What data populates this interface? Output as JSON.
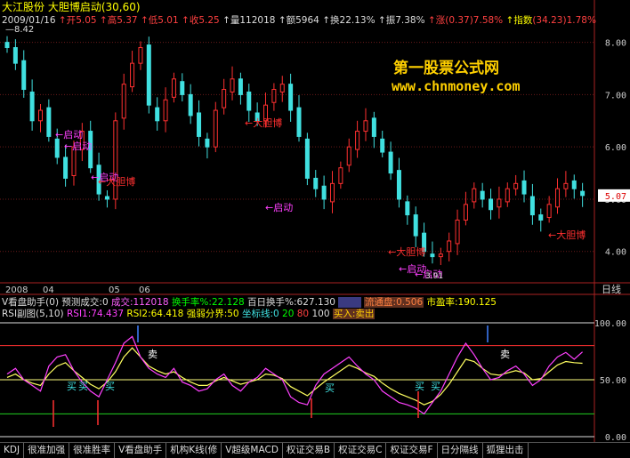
{
  "header": {
    "stock_name": "大江股份",
    "indicator": "大胆博启动(30,60)",
    "date": "2009/01/16",
    "open_label": "↑开",
    "open": "5.05",
    "high_label": "↑高",
    "high": "5.37",
    "low_label": "↑低",
    "low": "5.01",
    "close_label": "↑收",
    "close": "5.25",
    "vol_label": "↑量",
    "vol": "112018",
    "amt_label": "↑额",
    "amt": "5964",
    "turn_label": "↑换",
    "turn": "22.13%",
    "amp_label": "↑振",
    "amp": "7.38%",
    "chg_label": "↑涨",
    "chg": "(0.37)7.58%",
    "idx_label": "↑指数",
    "idx": "(34.23)1.78%",
    "hi_mark": "8.42"
  },
  "watermark": {
    "line1": "第一股票公式网",
    "line2": "www.chnmoney.com"
  },
  "price_axis": {
    "ticks": [
      "8.00",
      "7.00",
      "6.00",
      "5.00",
      "4.00"
    ],
    "current": "5.07"
  },
  "time_axis": {
    "labels": [
      "2008",
      "04",
      "05",
      "06"
    ],
    "period": "日线"
  },
  "annotations": [
    "启动",
    "启动",
    "启动",
    "大胆博",
    "大胆博",
    "启动",
    "大胆博",
    "启动",
    "启动",
    "3.91",
    "大胆博"
  ],
  "info1": {
    "name": "V看盘助手(0)",
    "fc_label": "预测成交:0",
    "deal": "成交:112018",
    "turn": "换手率%:22.128",
    "turn100": "百日换手%:627.130",
    "ltp": "流通盘:0.506",
    "pe": "市盈率:190.125"
  },
  "info2": {
    "name": "RSI副图(5,10)",
    "rsi1": "RSI1:74.437",
    "rsi2": "RSI2:64.418",
    "line": "强弱分界:50",
    "coord": "坐标线:0",
    "v20": "20",
    "v80": "80",
    "v100": "100",
    "signal": "买入:卖出"
  },
  "rsi_axis": {
    "ticks": [
      "100.00",
      "50.00",
      "0.00"
    ]
  },
  "rsi_labels": {
    "buy": "买",
    "sell": "卖"
  },
  "tabs": [
    "KDJ",
    "很准加强",
    "很准胜率",
    "V看盘助手",
    "机构K线(修",
    "V超级MACD",
    "权证交易B",
    "权证交易C",
    "权证交易F",
    "日分隔线",
    "狐狸出击"
  ],
  "chart_data": {
    "type": "candlestick",
    "y_ticks": [
      4,
      5,
      6,
      7,
      8
    ],
    "close_series": [
      7.9,
      7.6,
      7.1,
      6.5,
      6.7,
      6.2,
      5.8,
      5.4,
      6.0,
      6.3,
      5.6,
      5.1,
      5.0,
      6.5,
      7.2,
      7.6,
      7.9,
      6.8,
      6.5,
      6.9,
      7.3,
      7.0,
      6.6,
      6.2,
      6.0,
      6.7,
      7.1,
      7.3,
      7.0,
      6.7,
      6.5,
      6.8,
      7.1,
      7.2,
      6.7,
      6.2,
      5.4,
      5.2,
      5.0,
      5.3,
      5.6,
      6.0,
      6.3,
      6.5,
      6.2,
      5.9,
      5.5,
      5.0,
      4.7,
      4.3,
      4.0,
      3.9,
      3.95,
      4.2,
      4.6,
      4.9,
      5.2,
      5.0,
      4.8,
      5.0,
      5.2,
      5.3,
      5.1,
      4.7,
      4.6,
      4.9,
      5.2,
      5.3,
      5.2,
      5.07
    ],
    "rsi1_series": [
      55,
      60,
      50,
      45,
      40,
      62,
      70,
      72,
      58,
      48,
      40,
      35,
      50,
      65,
      82,
      88,
      70,
      60,
      55,
      52,
      60,
      48,
      45,
      40,
      42,
      50,
      55,
      45,
      40,
      48,
      52,
      60,
      55,
      50,
      35,
      30,
      28,
      45,
      55,
      60,
      65,
      70,
      62,
      55,
      50,
      40,
      35,
      30,
      28,
      25,
      20,
      30,
      40,
      55,
      70,
      82,
      72,
      60,
      50,
      52,
      58,
      62,
      55,
      45,
      50,
      62,
      70,
      74,
      68,
      74.437
    ],
    "rsi2_series": [
      52,
      55,
      50,
      47,
      45,
      55,
      62,
      65,
      58,
      52,
      46,
      42,
      48,
      57,
      70,
      78,
      70,
      62,
      58,
      55,
      57,
      52,
      48,
      45,
      45,
      49,
      52,
      49,
      46,
      48,
      50,
      55,
      54,
      51,
      44,
      40,
      36,
      42,
      48,
      53,
      58,
      63,
      60,
      56,
      53,
      47,
      42,
      38,
      35,
      32,
      28,
      31,
      37,
      46,
      57,
      68,
      66,
      60,
      55,
      54,
      56,
      58,
      56,
      50,
      51,
      57,
      63,
      66,
      65,
      64.418
    ],
    "rsi_levels": {
      "top": 100,
      "upper": 80,
      "mid": 50,
      "lower": 20,
      "bottom": 0
    }
  }
}
